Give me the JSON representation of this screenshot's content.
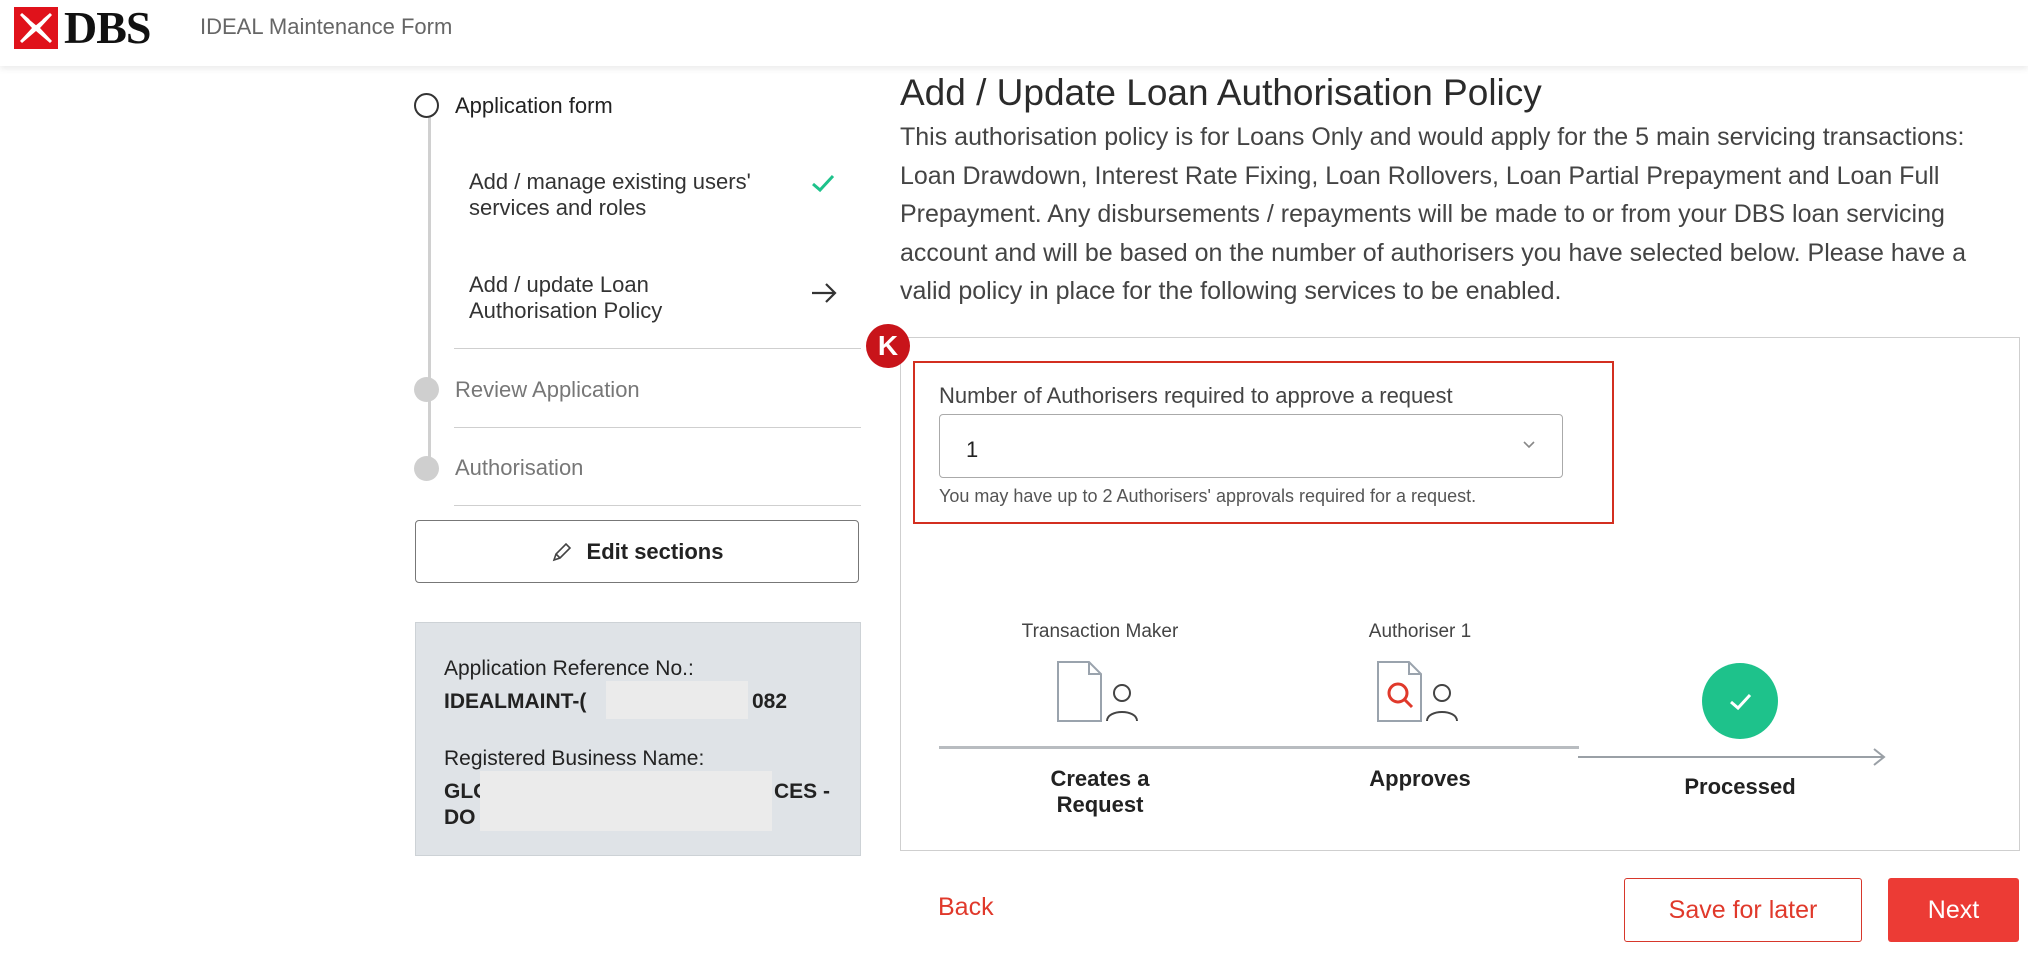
{
  "header": {
    "logo_text": "DBS",
    "app_title": "IDEAL Maintenance Form"
  },
  "nav": {
    "steps": [
      {
        "label": "Application form",
        "state": "current"
      },
      {
        "label": "Review Application",
        "state": "pending"
      },
      {
        "label": "Authorisation",
        "state": "pending"
      }
    ],
    "substeps": [
      {
        "line1": "Add / manage existing users'",
        "line2": "services and roles",
        "status": "done"
      },
      {
        "line1": "Add / update Loan",
        "line2": "Authorisation Policy",
        "status": "current"
      }
    ],
    "edit_sections_label": "Edit sections"
  },
  "reference": {
    "ref_label": "Application Reference No.:",
    "ref_value_start": "IDEALMAINT-(",
    "ref_value_end": "082",
    "business_label": "Registered Business Name:",
    "business_line1_start": "GLOI",
    "business_line1_end": "CES -",
    "business_line2_start": "DO N"
  },
  "main": {
    "title": "Add / Update Loan Authorisation Policy",
    "description": "This authorisation policy is for Loans Only and would apply for the 5 main servicing transactions: Loan Drawdown, Interest Rate Fixing, Loan Rollovers, Loan Partial Prepayment and Loan Full Prepayment. Any disbursements / repayments will be made to or from your DBS loan servicing account and will be based on the number of authorisers you have selected below. Please have a valid policy in place for the following services to be enabled.",
    "annotation_badge": "K",
    "authorisers_field": {
      "label": "Number of Authorisers required to approve a request",
      "value": "1",
      "hint": "You may have up to 2 Authorisers' approvals required for a request."
    },
    "flow": {
      "maker_label": "Transaction Maker",
      "maker_caption_1": "Creates a",
      "maker_caption_2": "Request",
      "authoriser_label": "Authoriser 1",
      "authoriser_caption": "Approves",
      "processed_caption": "Processed"
    }
  },
  "footer": {
    "back_label": "Back",
    "save_label": "Save for later",
    "next_label": "Next"
  },
  "colors": {
    "brand_red": "#e0392b",
    "success_green": "#1ec28b",
    "highlight_border": "#d32f20"
  }
}
